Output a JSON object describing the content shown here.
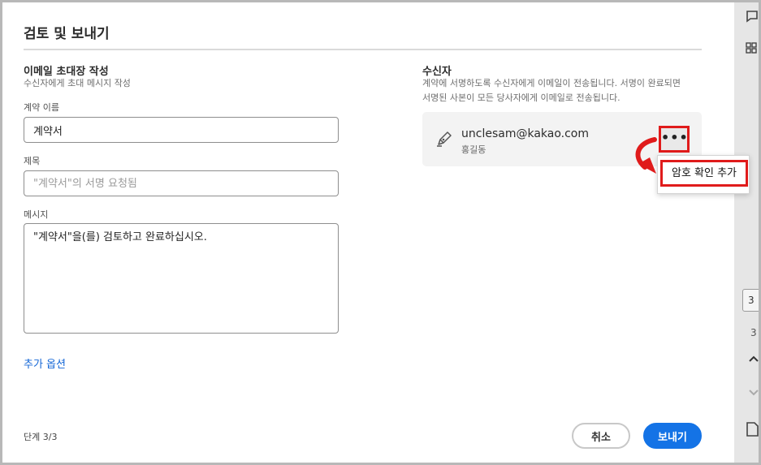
{
  "dialog": {
    "title": "검토 및 보내기",
    "step": "단계 3/3"
  },
  "invite": {
    "heading": "이메일 초대장 작성",
    "subheading": "수신자에게 초대 메시지 작성",
    "agreement_name_label": "계약 이름",
    "agreement_name_value": "계약서",
    "subject_label": "제목",
    "subject_placeholder": "\"계약서\"의 서명 요청됨",
    "message_label": "메시지",
    "message_value": "\"계약서\"을(를) 검토하고 완료하십시오.",
    "more_options": "추가 옵션"
  },
  "recipients": {
    "heading": "수신자",
    "description_line1": "계약에 서명하도록 수신자에게 이메일이 전송됩니다. 서명이 완료되면",
    "description_line2": "서명된 사본이 모든 당사자에게 이메일로 전송됩니다.",
    "items": [
      {
        "email": "unclesam@kakao.com",
        "name": "홍길동",
        "more_label": "•••"
      }
    ],
    "menu": {
      "add_password": "암호 확인 추가"
    }
  },
  "buttons": {
    "cancel": "취소",
    "send": "보내기"
  },
  "background": {
    "tile_top": "3",
    "tile_mid": "3"
  },
  "colors": {
    "accent": "#1473e6",
    "highlight": "#e01b1b"
  }
}
